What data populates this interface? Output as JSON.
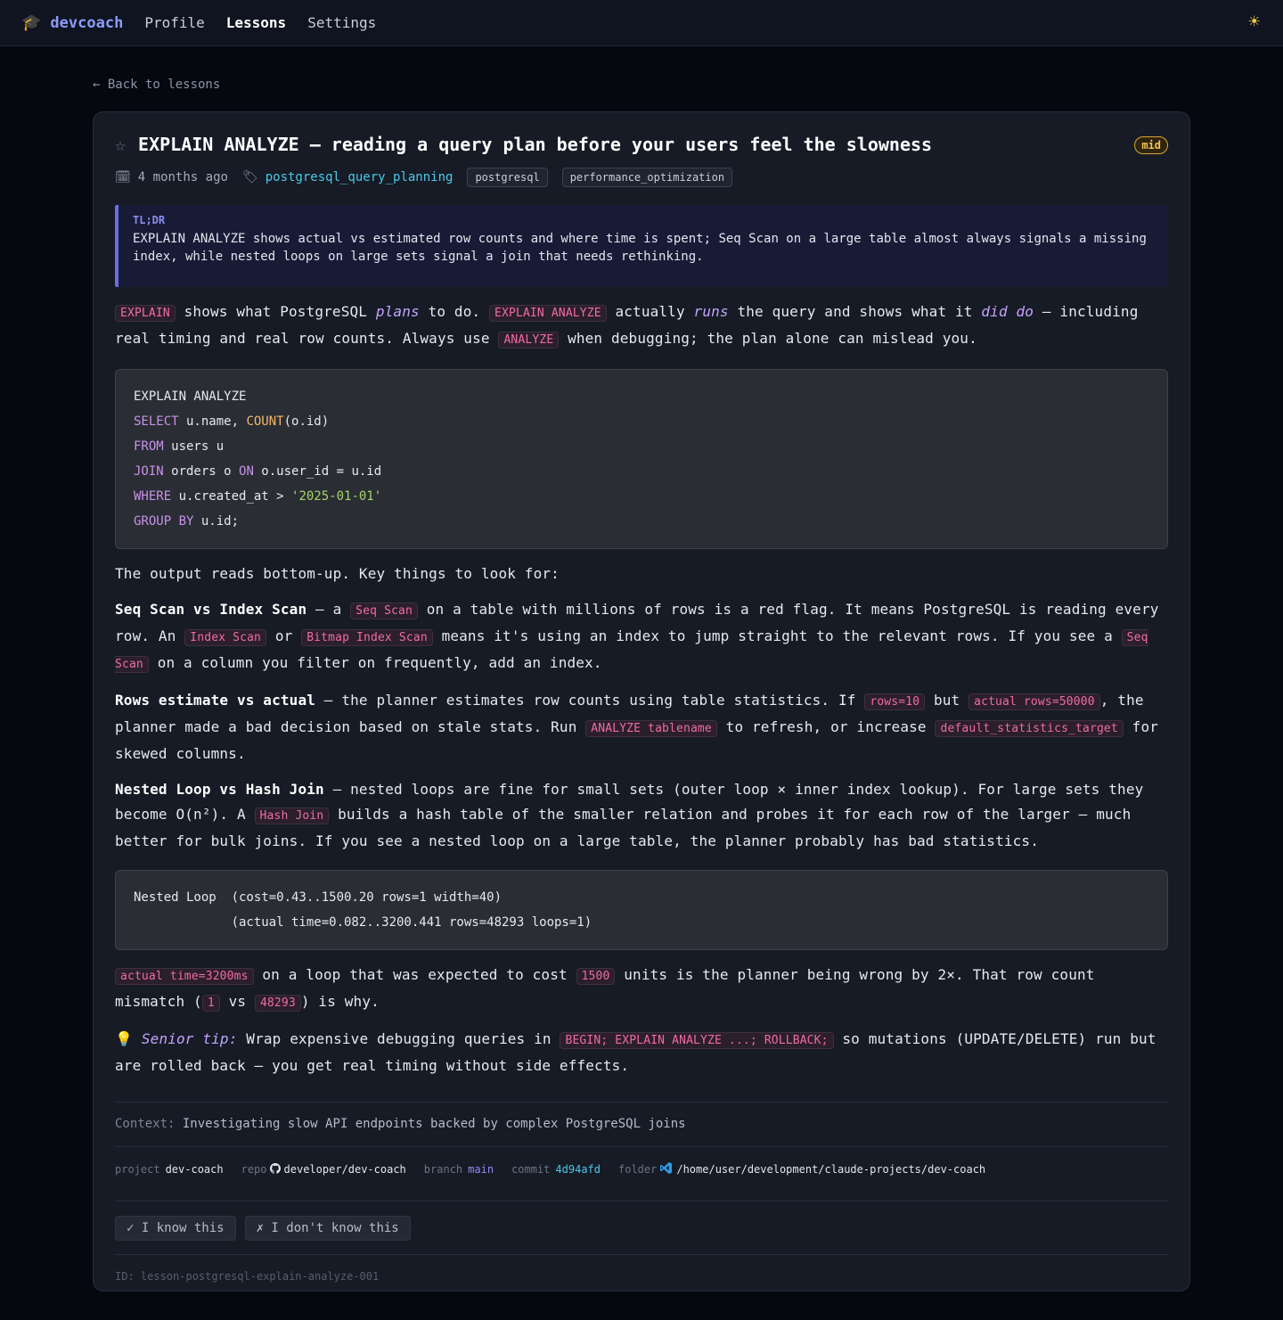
{
  "nav": {
    "brand": "devcoach",
    "links": [
      "Profile",
      "Lessons",
      "Settings"
    ],
    "active": "Lessons",
    "theme_icon": "sun-icon"
  },
  "back_link": "← Back to lessons",
  "lesson": {
    "title": "EXPLAIN ANALYZE — reading a query plan before your users feel the slowness",
    "level": "mid",
    "date": "4 months ago",
    "topic": "postgresql_query_planning",
    "tags": [
      "postgresql",
      "performance_optimization"
    ],
    "tldr_label": "TL;DR",
    "tldr": "EXPLAIN ANALYZE shows actual vs estimated row counts and where time is spent; Seq Scan on a large table almost always signals a missing index, while nested loops on large sets signal a join that needs rethinking.",
    "p1": {
      "c1": "EXPLAIN",
      "t1": " shows what PostgreSQL ",
      "em1": "plans",
      "t2": " to do. ",
      "c2": "EXPLAIN ANALYZE",
      "t3": " actually ",
      "em2": "runs",
      "t4": " the query and shows what it ",
      "em3": "did do",
      "t5": " — including real timing and real row counts. Always use ",
      "c3": "ANALYZE",
      "t6": " when debugging; the plan alone can mislead you."
    },
    "code1": {
      "l1": "EXPLAIN ANALYZE",
      "l2_kw": "SELECT",
      "l2_a": " u.name, ",
      "l2_fn": "COUNT",
      "l2_b": "(o.id)",
      "l3_kw": "FROM",
      "l3_a": " users u",
      "l4_kw": "JOIN",
      "l4_a": " orders o ",
      "l4_kw2": "ON",
      "l4_b": " o.user_id = u.id",
      "l5_kw": "WHERE",
      "l5_a": " u.created_at > ",
      "l5_str": "'2025-01-01'",
      "l6_kw": "GROUP BY",
      "l6_a": " u.id;"
    },
    "p2": "The output reads bottom-up. Key things to look for:",
    "p3": {
      "b": "Seq Scan vs Index Scan",
      "t1": " — a ",
      "c1": "Seq Scan",
      "t2": " on a table with millions of rows is a red flag. It means PostgreSQL is reading every row. An ",
      "c2": "Index Scan",
      "t3": " or ",
      "c3": "Bitmap Index Scan",
      "t4": " means it's using an index to jump straight to the relevant rows. If you see a ",
      "c4": "Seq Scan",
      "t5": " on a column you filter on frequently, add an index."
    },
    "p4": {
      "b": "Rows estimate vs actual",
      "t1": " — the planner estimates row counts using table statistics. If ",
      "c1": "rows=10",
      "t2": " but ",
      "c2": "actual rows=50000",
      "t3": ", the planner made a bad decision based on stale stats. Run ",
      "c3": "ANALYZE tablename",
      "t4": " to refresh, or increase ",
      "c4": "default_statistics_target",
      "t5": " for skewed columns."
    },
    "p5": {
      "b": "Nested Loop vs Hash Join",
      "t1": " — nested loops are fine for small sets (outer loop × inner index lookup). For large sets they become O(n²). A ",
      "c1": "Hash Join",
      "t2": " builds a hash table of the smaller relation and probes it for each row of the larger — much better for bulk joins. If you see a nested loop on a large table, the planner probably has bad statistics."
    },
    "code2": {
      "l1": "Nested Loop  (cost=0.43..1500.20 rows=1 width=40)",
      "l2": "             (actual time=0.082..3200.441 rows=48293 loops=1)"
    },
    "p6": {
      "c1": "actual time=3200ms",
      "t1": " on a loop that was expected to cost ",
      "c2": "1500",
      "t2": " units is the planner being wrong by 2×. That row count mismatch (",
      "c3": "1",
      "t3": " vs ",
      "c4": "48293",
      "t4": ") is why."
    },
    "tip": {
      "icon": "💡",
      "label": "Senior tip:",
      "t1": " Wrap expensive debugging queries in ",
      "c1": "BEGIN; EXPLAIN ANALYZE ...; ROLLBACK;",
      "t2": " so mutations (UPDATE/DELETE) run but are rolled back — you get real timing without side effects."
    },
    "context_label": "Context:",
    "context": " Investigating slow API endpoints backed by complex PostgreSQL joins",
    "meta": {
      "project_label": "project",
      "project": "dev-coach",
      "repo_label": "repo",
      "repo": "developer/dev-coach",
      "branch_label": "branch",
      "branch": "main",
      "commit_label": "commit",
      "commit": "4d94afd",
      "folder_label": "folder",
      "folder": "/home/user/development/claude-projects/dev-coach"
    },
    "buttons": {
      "know": "✓ I know this",
      "dont_know": "✗ I don't know this"
    },
    "id_line": "ID: lesson-postgresql-explain-analyze-001"
  },
  "colors": {
    "background": "#05080f",
    "card": "#161b25",
    "accent": "#8b9cf7",
    "inline_code": "#f06ba4",
    "topic_link": "#4cc9ea",
    "badge": "#f2c451"
  }
}
